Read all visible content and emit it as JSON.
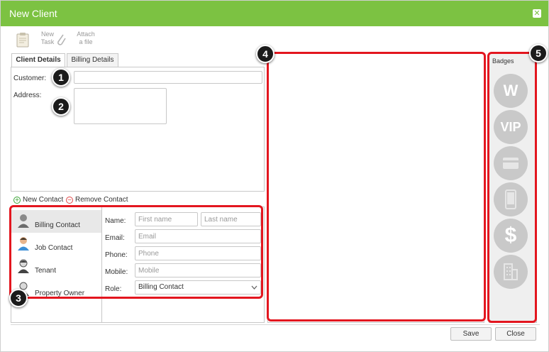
{
  "window": {
    "title": "New Client",
    "close_glyph": "✕"
  },
  "toolbar": {
    "new_task": {
      "line1": "New",
      "line2": "Task",
      "icon": "clipboard-icon"
    },
    "attach_file": {
      "line1": "Attach",
      "line2": "a file",
      "icon": "paperclip-icon"
    }
  },
  "tabs": [
    {
      "label": "Client Details",
      "active": true
    },
    {
      "label": "Billing Details",
      "active": false
    }
  ],
  "client_form": {
    "customer_label": "Customer:",
    "customer_value": "",
    "address_label": "Address:",
    "address_value": ""
  },
  "contact_actions": {
    "new_label": "New Contact",
    "remove_label": "Remove Contact"
  },
  "contacts": [
    {
      "name": "Billing Contact",
      "selected": true,
      "color": "#7a7a7a"
    },
    {
      "name": "Job Contact",
      "selected": false,
      "color": "#3d8fd6"
    },
    {
      "name": "Tenant",
      "selected": false,
      "color": "#555555"
    },
    {
      "name": "Property Owner",
      "selected": false,
      "color": "#555555"
    }
  ],
  "contact_form": {
    "name_label": "Name:",
    "first_placeholder": "First name",
    "last_placeholder": "Last name",
    "email_label": "Email:",
    "email_placeholder": "Email",
    "phone_label": "Phone:",
    "phone_placeholder": "Phone",
    "mobile_label": "Mobile:",
    "mobile_placeholder": "Mobile",
    "role_label": "Role:",
    "role_value": "Billing Contact"
  },
  "badges": {
    "title": "Badges",
    "items": [
      {
        "text": "W",
        "icon": "w-badge-icon"
      },
      {
        "text": "VIP",
        "icon": "vip-badge-icon"
      },
      {
        "text": "",
        "icon": "credit-card-icon"
      },
      {
        "text": "",
        "icon": "mobile-phone-icon"
      },
      {
        "text": "$",
        "icon": "dollar-icon"
      },
      {
        "text": "",
        "icon": "building-icon"
      }
    ]
  },
  "callouts": [
    "1",
    "2",
    "3",
    "4",
    "5"
  ],
  "footer": {
    "save_label": "Save",
    "close_label": "Close"
  },
  "colors": {
    "titlebar": "#7cc242",
    "highlight": "#e3161f",
    "badge": "#c9c9c9"
  }
}
